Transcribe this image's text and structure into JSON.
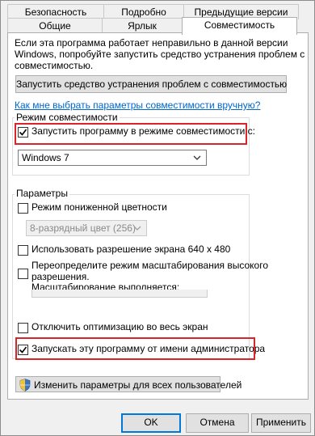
{
  "tabs": {
    "row1": [
      "Безопасность",
      "Подробно",
      "Предыдущие версии"
    ],
    "row2": [
      "Общие",
      "Ярлык",
      "Совместимость"
    ]
  },
  "intro": {
    "line1": "Если эта программа работает неправильно в данной версии",
    "line2": "Windows, попробуйте запустить средство устранения проблем с",
    "line3": "совместимостью."
  },
  "troubleshoot_button": "Запустить средство устранения проблем с совместимостью",
  "help_link": "Как мне выбрать параметры совместимости вручную?",
  "compat_group": {
    "legend": "Режим совместимости",
    "checkbox_label": "Запустить программу в режиме совместимости с:",
    "checked": true,
    "os_selected": "Windows 7"
  },
  "params_group": {
    "legend": "Параметры",
    "reduced_color_label": "Режим пониженной цветности",
    "color_selected": "8-разрядный цвет (256)",
    "resolution_label": "Использовать разрешение экрана 640 x 480",
    "dpi_label_line1": "Переопределите режим масштабирования высокого",
    "dpi_label_line2": "разрешения.",
    "dpi_label_line3": "Масштабирование выполняется:",
    "fullscreen_label": "Отключить оптимизацию во весь экран",
    "admin_label": "Запускать эту программу от имени администратора",
    "admin_checked": true
  },
  "all_users_button": "Изменить параметры для всех пользователей",
  "footer": {
    "ok": "OK",
    "cancel": "Отмена",
    "apply": "Применить"
  },
  "colors": {
    "highlight": "#d9252a",
    "link": "#0066cc",
    "check": "#000000"
  },
  "icons": {
    "shield": "uac-shield-icon",
    "dropdown": "chevron-down-icon",
    "check": "checkmark-icon"
  }
}
